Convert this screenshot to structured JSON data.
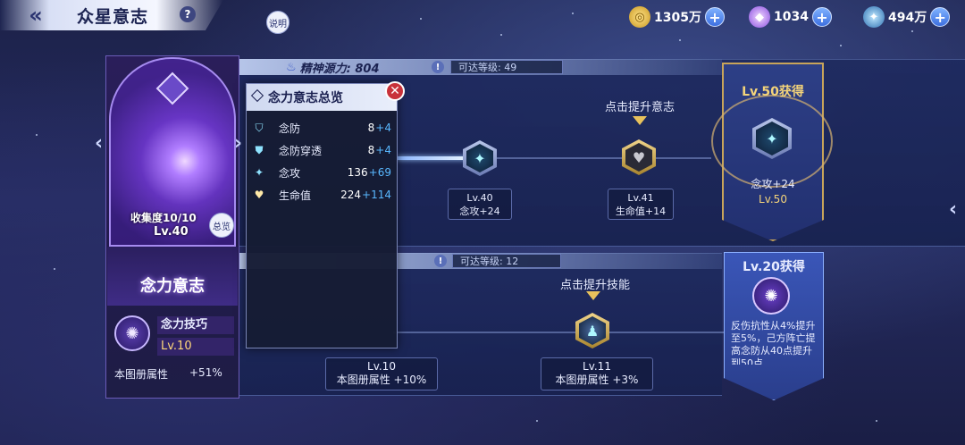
{
  "header": {
    "title": "众星意志",
    "help_glyph": "?",
    "explain_label": "说明"
  },
  "resources": [
    {
      "icon": "gold-coin-icon",
      "value": "1305万",
      "color": "#e8c34a"
    },
    {
      "icon": "diamond-icon",
      "value": "1034",
      "color": "#b77cff"
    },
    {
      "icon": "star-shard-icon",
      "value": "494万",
      "color": "#6cc4ff"
    }
  ],
  "spirit_bar": {
    "label": "精神源力: 804"
  },
  "track1": {
    "reach_level": "可达等级: 49",
    "hint": "点击提升意志",
    "nodes": [
      {
        "lvl": "Lv.40",
        "effect": "念攻+24"
      },
      {
        "lvl": "Lv.41",
        "effect": "生命值+14"
      }
    ],
    "reward": {
      "title": "Lv.50获得",
      "effect": "念攻+24",
      "lvl": "Lv.50"
    }
  },
  "track2": {
    "reach_level": "可达等级: 12",
    "hint": "点击提升技能",
    "nodes": [
      {
        "lvl": "Lv.10",
        "effect": "本图册属性 +10%"
      },
      {
        "lvl": "Lv.11",
        "effect": "本图册属性 +3%"
      }
    ],
    "reward": {
      "title": "Lv.20获得",
      "desc": "反伤抗性从4%提升至5%，己方阵亡提高念防从40点提升到50点"
    }
  },
  "card": {
    "collection": "收集度10/10",
    "level": "Lv.40",
    "overview_btn": "总览",
    "name": "念力意志",
    "skill_name": "念力技巧",
    "skill_level": "Lv.10",
    "bonus_label": "本图册属性",
    "bonus_value": "+51%"
  },
  "overview": {
    "title": "念力意志总览",
    "close_glyph": "✕",
    "stats": [
      {
        "name": "念防",
        "value": "8",
        "bonus": "+4"
      },
      {
        "name": "念防穿透",
        "value": "8",
        "bonus": "+4"
      },
      {
        "name": "念攻",
        "value": "136",
        "bonus": "+69"
      },
      {
        "name": "生命值",
        "value": "224",
        "bonus": "+114"
      }
    ]
  }
}
